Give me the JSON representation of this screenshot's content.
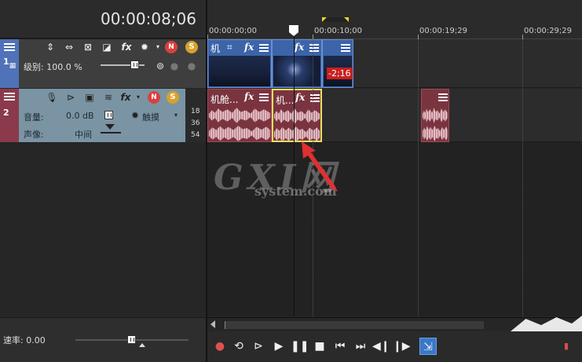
{
  "timecode": "00:00:08;06",
  "ruler": {
    "labels": [
      "00:00:00;00",
      "00:00:10;00",
      "00:00:19;29",
      "00:00:29;29"
    ]
  },
  "video_track": {
    "number": "1",
    "level_label": "级别: 100.0 %",
    "clips": [
      {
        "title": "机"
      },
      {
        "title": ""
      },
      {
        "title": ""
      }
    ],
    "time_badge": "-2;16"
  },
  "audio_track": {
    "number": "2",
    "volume_label": "音量:",
    "volume_value": "0.0 dB",
    "pan_label": "声像:",
    "pan_value": "中间",
    "mode_label": "触摸",
    "meter": [
      "18",
      "36",
      "54"
    ],
    "clips": [
      {
        "title": "机舱..."
      },
      {
        "title": "机..."
      },
      {
        "title": ""
      }
    ]
  },
  "bottom": {
    "rate_label": "速率: 0.00"
  },
  "watermark": {
    "big": "GXI网",
    "small": "system.com"
  },
  "colors": {
    "video_track": "#4f72b8",
    "audio_track": "#8a3a4a",
    "audio_header": "#7a94a3",
    "selection": "#e8e060",
    "arrow": "#e03030"
  },
  "transport": {
    "icons": [
      "record-icon",
      "loop-icon",
      "play-from-start-icon",
      "play-icon",
      "pause-icon",
      "stop-icon",
      "prev-marker-icon",
      "next-marker-icon",
      "prev-frame-icon",
      "next-frame-icon",
      "snap-icon"
    ]
  }
}
